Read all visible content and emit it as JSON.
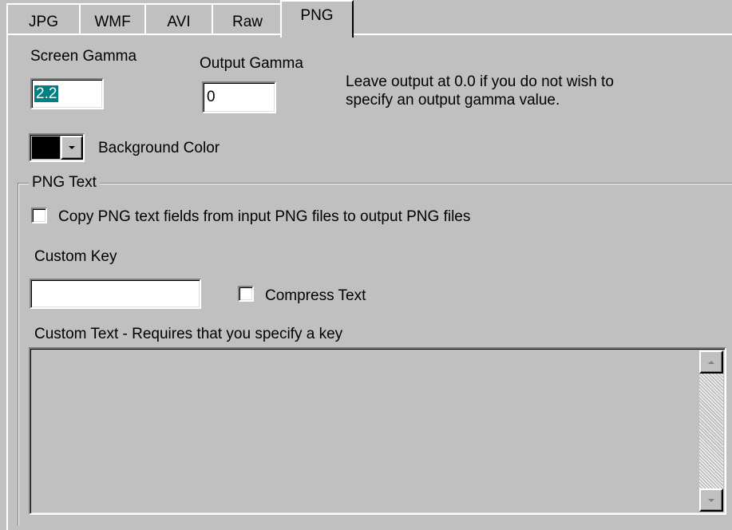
{
  "tabs": [
    {
      "label": "JPG",
      "active": false
    },
    {
      "label": "WMF",
      "active": false
    },
    {
      "label": "AVI",
      "active": false
    },
    {
      "label": "Raw",
      "active": false
    },
    {
      "label": "PNG",
      "active": true
    }
  ],
  "gamma": {
    "screen_label": "Screen Gamma",
    "screen_value": "2.2",
    "output_label": "Output Gamma",
    "output_value": "0",
    "hint_line1": "Leave output at 0.0 if you do not wish to",
    "hint_line2": "specify an output gamma value."
  },
  "background": {
    "label": "Background Color",
    "swatch_color": "#000000"
  },
  "png_text": {
    "group_title": "PNG Text",
    "copy_label": "Copy PNG text fields from input PNG files to output PNG files",
    "copy_checked": false,
    "custom_key_label": "Custom Key",
    "custom_key_value": "",
    "compress_label": "Compress Text",
    "compress_checked": false,
    "custom_text_label": "Custom Text - Requires that you specify a key",
    "custom_text_value": ""
  }
}
